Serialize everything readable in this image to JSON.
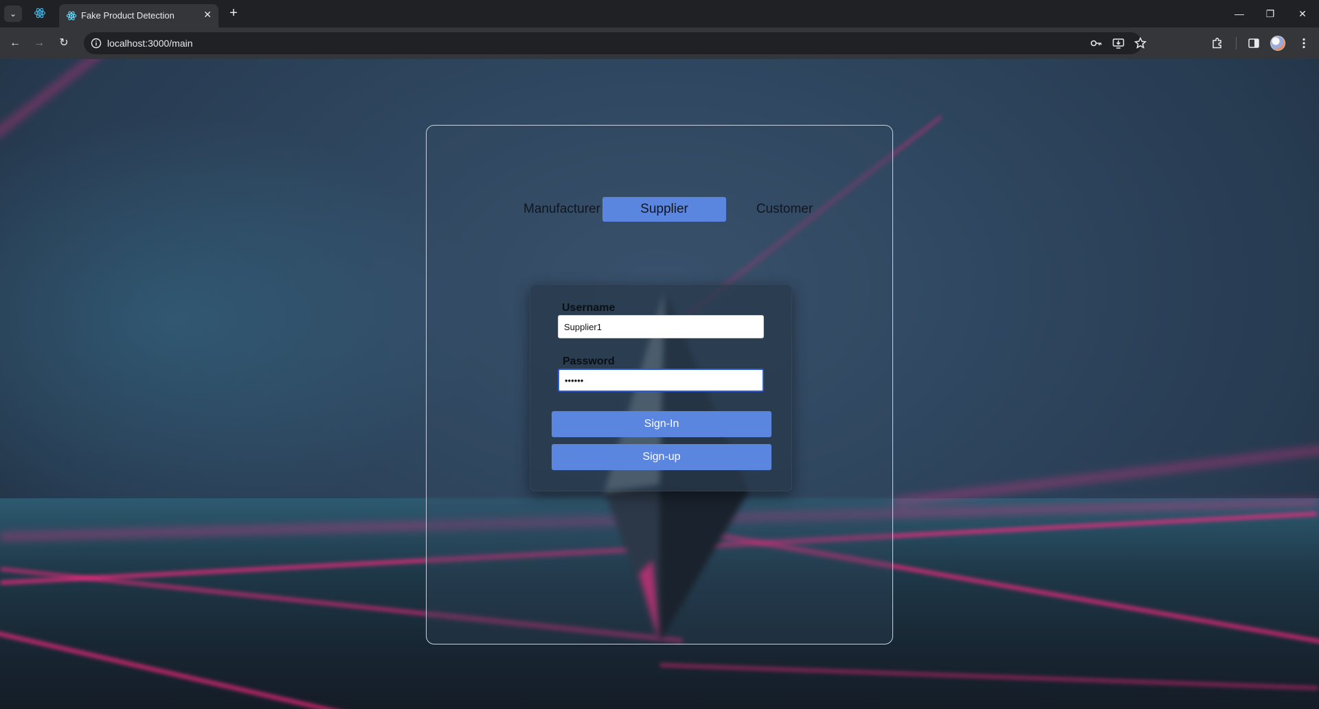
{
  "browser": {
    "tab_title": "Fake Product Detection",
    "url": "localhost:3000/main"
  },
  "page": {
    "roles": [
      "Manufacturer",
      "Supplier",
      "Customer"
    ],
    "active_role": "Supplier",
    "login": {
      "username_label": "Username",
      "username_value": "Supplier1",
      "password_label": "Password",
      "password_value": "••••••",
      "signin_label": "Sign-In",
      "signup_label": "Sign-up"
    }
  },
  "colors": {
    "accent": "#5b86e0",
    "laser": "#ff2882",
    "panel_border": "#c8d3df"
  },
  "icons": {
    "tab_list": "chevron-down-icon",
    "pinned_tab": "react-icon",
    "favicon": "react-icon",
    "tab_close": "close-icon",
    "new_tab": "plus-icon",
    "back": "back-arrow-icon",
    "forward": "forward-arrow-icon",
    "reload": "reload-icon",
    "site_info": "info-icon",
    "password_key": "key-icon",
    "install_app": "install-icon",
    "bookmark": "star-icon",
    "extensions": "puzzle-icon",
    "side_panel": "side-panel-icon",
    "menu": "kebab-menu-icon"
  }
}
